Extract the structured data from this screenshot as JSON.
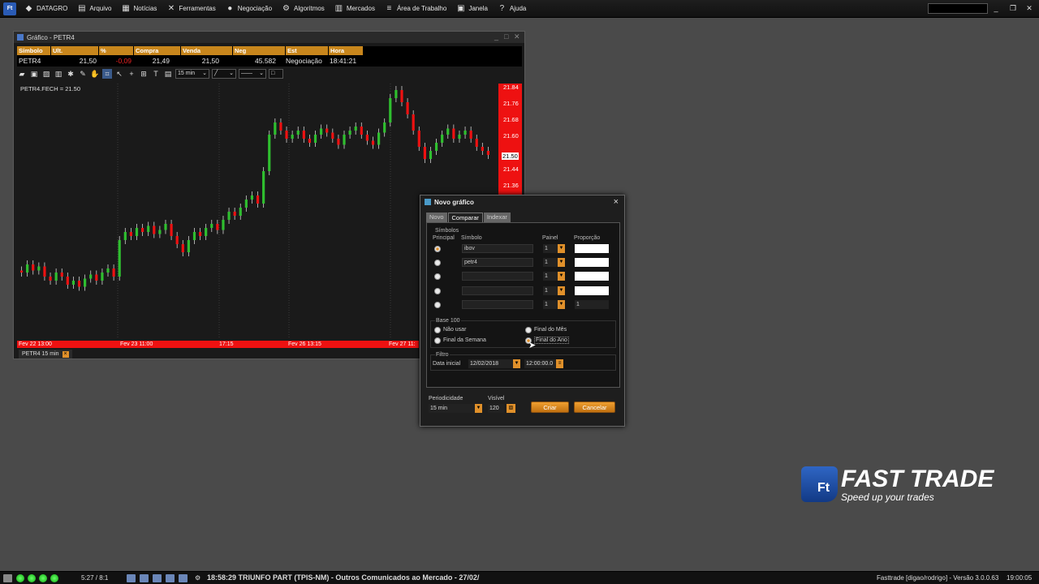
{
  "menu": {
    "app_badge": "Ft",
    "items": [
      {
        "label": "DATAGRO",
        "icon": "datagro-icon",
        "glyph": "◆"
      },
      {
        "label": "Arquivo",
        "icon": "file-icon",
        "glyph": "▤"
      },
      {
        "label": "Notícias",
        "icon": "news-icon",
        "glyph": "▦"
      },
      {
        "label": "Ferramentas",
        "icon": "tools-icon",
        "glyph": "✕"
      },
      {
        "label": "Negociação",
        "icon": "trade-icon",
        "glyph": "●"
      },
      {
        "label": "Algoritmos",
        "icon": "algorithm-icon",
        "glyph": "⚙"
      },
      {
        "label": "Mercados",
        "icon": "markets-icon",
        "glyph": "▥"
      },
      {
        "label": "Área de Trabalho",
        "icon": "workspace-icon",
        "glyph": "≡"
      },
      {
        "label": "Janela",
        "icon": "window-icon",
        "glyph": "▣"
      },
      {
        "label": "Ajuda",
        "icon": "help-icon",
        "glyph": "?"
      }
    ]
  },
  "chart_window": {
    "title": "Gráfico - PETR4",
    "quote_headers": [
      "Símbolo",
      "Ult.",
      "%",
      "Compra",
      "Venda",
      "Neg",
      "Est",
      "Hora"
    ],
    "quote_values": {
      "symbol": "PETR4",
      "last": "21,50",
      "pct": "-0,09",
      "bid": "21,49",
      "ask": "21,50",
      "trades": "45.582",
      "status": "Negociação",
      "time": "18:41:21"
    },
    "interval": "15 min",
    "series_label": "PETR4.FECH = 21.50",
    "price_ticks": [
      "21.84",
      "21.76",
      "21.68",
      "21.60",
      "21.52",
      "21.44",
      "21.36"
    ],
    "current_price": "21.50",
    "time_ticks": [
      "Fev 22 13:00",
      "Fev 23 11:00",
      "17:15",
      "Fev 26 13:15",
      "Fev 27 11:"
    ],
    "tab_label": "PETR4 15 min",
    "tab_close": "×"
  },
  "dialog": {
    "title": "Novo gráfico",
    "close": "×",
    "tabs": [
      "Novo",
      "Comparar",
      "Indexar"
    ],
    "active_tab": "Comparar",
    "symbols_group": "Símbolos",
    "col_principal": "Principal",
    "col_symbol": "Símbolo",
    "col_panel": "Painel",
    "col_proportion": "Proporção",
    "rows": [
      {
        "symbol": "ibov",
        "panel": "1",
        "proportion": ""
      },
      {
        "symbol": "petr4",
        "panel": "1",
        "proportion": ""
      },
      {
        "symbol": "",
        "panel": "1",
        "proportion": ""
      },
      {
        "symbol": "",
        "panel": "1",
        "proportion": ""
      },
      {
        "symbol": "",
        "panel": "1",
        "proportion": "1"
      }
    ],
    "base_group": "Base 100",
    "base_options": [
      "Não usar",
      "Final do Mês",
      "Final da Semana",
      "Final do Ano"
    ],
    "base_selected": "Final do Ano",
    "filter_group": "Filtro",
    "start_date_label": "Data inicial",
    "start_date": "12/02/2018",
    "start_time": "12:00:00.0",
    "periodicity_label": "Periodicidade",
    "periodicity": "15 min",
    "visible_label": "Visível",
    "visible": "120",
    "create_btn": "Criar",
    "cancel_btn": "Cancelar"
  },
  "logo": {
    "mark": "Ft",
    "title": "FAST TRADE",
    "tagline": "Speed up your trades"
  },
  "statusbar": {
    "ratio": "5:27 / 8:1",
    "ticker": "18:58:29 TRIUNFO PART (TPIS-NM) - Outros Comunicados ao Mercado - 27/02/",
    "version": "Fasttrade [digao/rodrigo] - Versão 3.0.0.63",
    "clock": "19:00:05"
  },
  "colors": {
    "accent": "#e0902a",
    "up": "#2fbf2f",
    "down": "#ee1111"
  },
  "chart_data": {
    "type": "candlestick",
    "series_label": "PETR4.FECH = 21.50",
    "interval": "15 min",
    "y_ticks": [
      21.84,
      21.76,
      21.68,
      21.6,
      21.52,
      21.44,
      21.36
    ],
    "last": 21.5,
    "close": [
      20.92,
      20.96,
      20.93,
      20.95,
      20.9,
      20.88,
      20.92,
      20.9,
      20.86,
      20.88,
      20.85,
      20.89,
      20.91,
      20.88,
      20.92,
      20.94,
      20.9,
      21.08,
      21.12,
      21.1,
      21.14,
      21.12,
      21.15,
      21.11,
      21.13,
      21.16,
      21.1,
      21.06,
      21.02,
      21.08,
      21.12,
      21.1,
      21.14,
      21.16,
      21.13,
      21.18,
      21.22,
      21.2,
      21.24,
      21.28,
      21.3,
      21.26,
      21.42,
      21.6,
      21.66,
      21.62,
      21.58,
      21.6,
      21.62,
      21.58,
      21.56,
      21.6,
      21.63,
      21.61,
      21.58,
      21.55,
      21.6,
      21.62,
      21.64,
      21.6,
      21.57,
      21.55,
      21.61,
      21.66,
      21.78,
      21.82,
      21.76,
      21.7,
      21.62,
      21.54,
      21.48,
      21.52,
      21.56,
      21.6,
      21.63,
      21.58,
      21.6,
      21.62,
      21.58,
      21.54,
      21.52,
      21.5
    ]
  }
}
